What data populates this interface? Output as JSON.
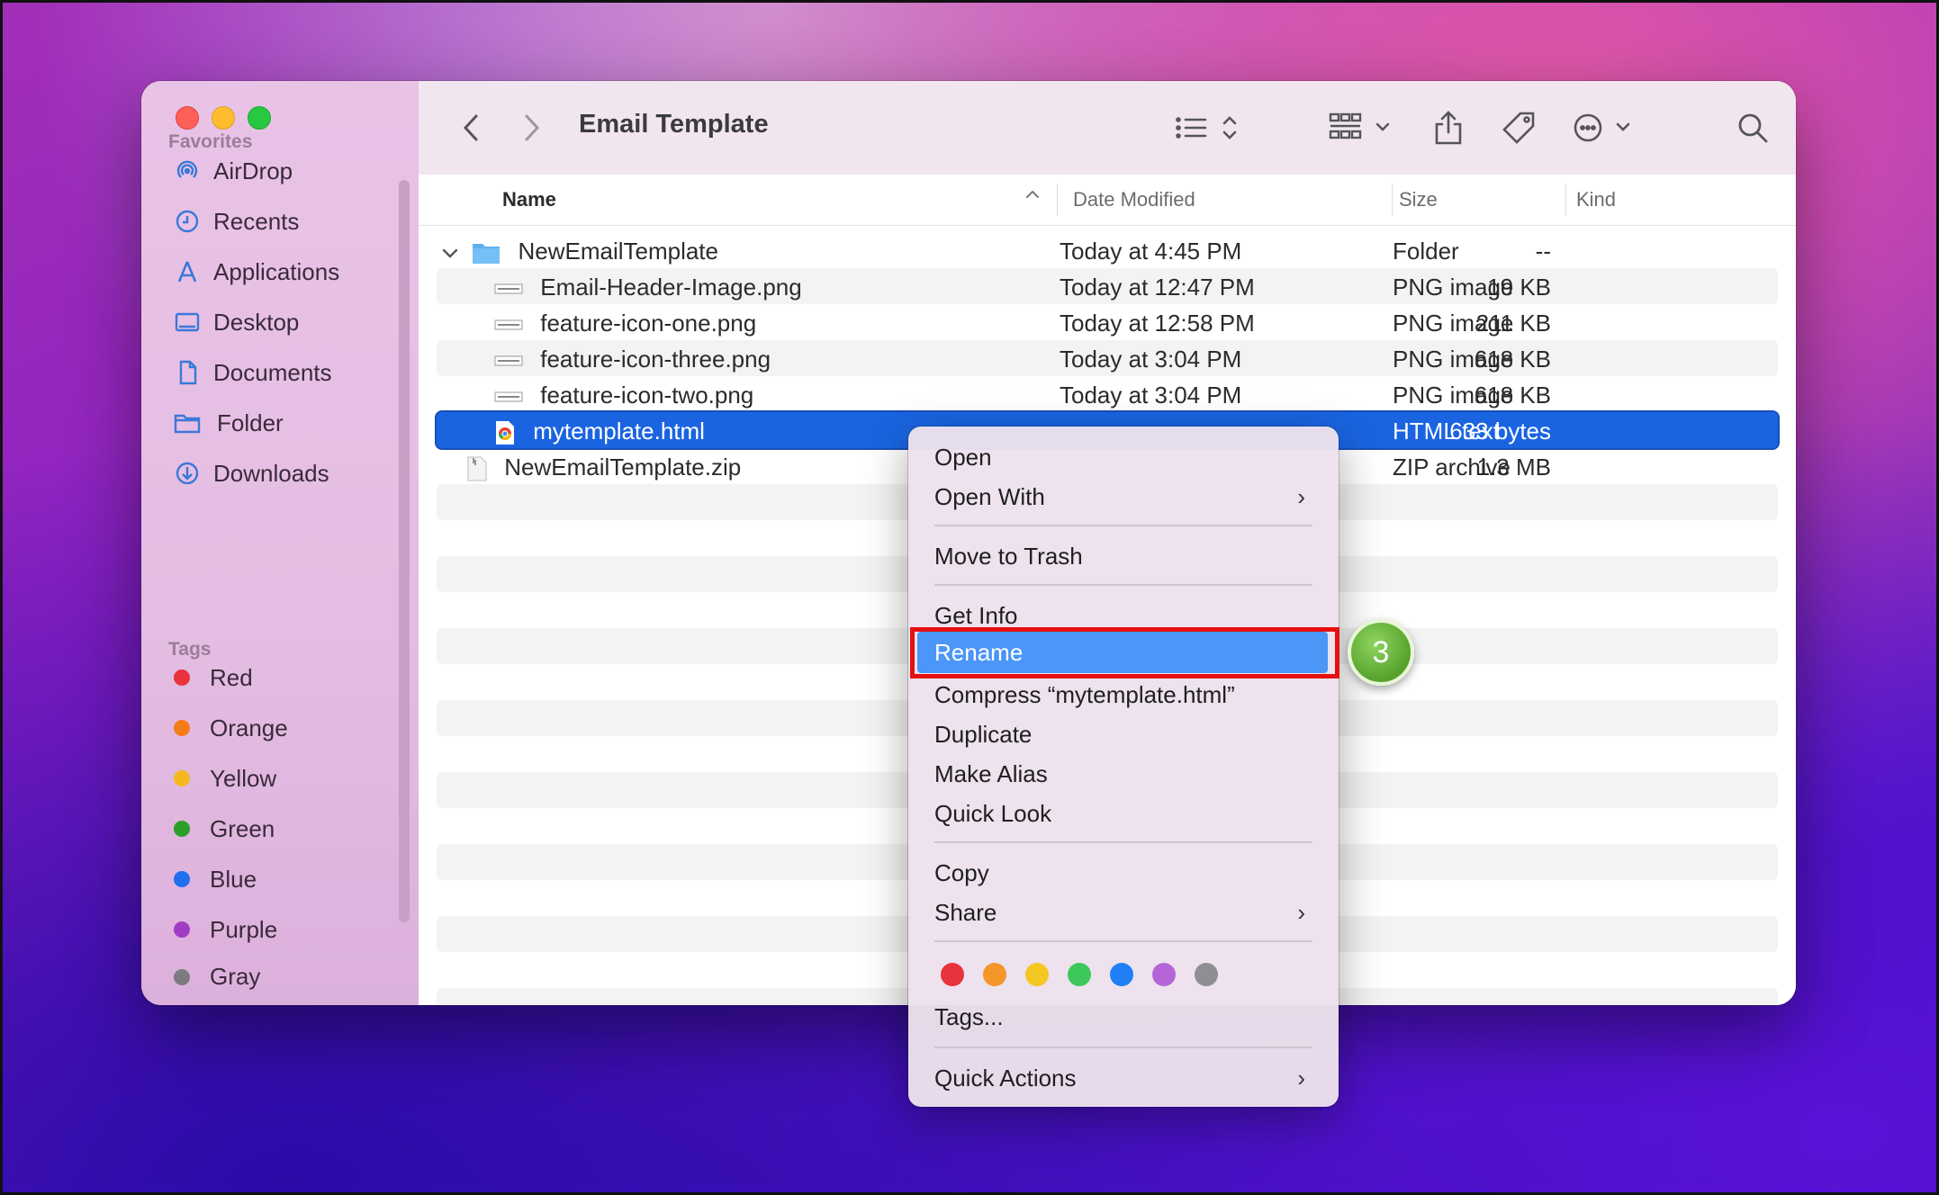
{
  "window": {
    "title": "Email Template"
  },
  "sidebar": {
    "favorites_header": "Favorites",
    "favorites": [
      {
        "label": "AirDrop",
        "icon": "airdrop-icon"
      },
      {
        "label": "Recents",
        "icon": "clock-icon"
      },
      {
        "label": "Applications",
        "icon": "applications-icon"
      },
      {
        "label": "Desktop",
        "icon": "desktop-icon"
      },
      {
        "label": "Documents",
        "icon": "document-icon"
      },
      {
        "label": "Folder",
        "icon": "folder-icon"
      },
      {
        "label": "Downloads",
        "icon": "download-icon"
      }
    ],
    "tags_header": "Tags",
    "tags": [
      {
        "label": "Red",
        "color": "#e8323c"
      },
      {
        "label": "Orange",
        "color": "#f57d19"
      },
      {
        "label": "Yellow",
        "color": "#f5b81e"
      },
      {
        "label": "Green",
        "color": "#2aa02a"
      },
      {
        "label": "Blue",
        "color": "#1f6ff0"
      },
      {
        "label": "Purple",
        "color": "#a13dc4"
      },
      {
        "label": "Gray",
        "color": "#7c7c80"
      }
    ]
  },
  "columns": {
    "name": "Name",
    "date": "Date Modified",
    "size": "Size",
    "kind": "Kind"
  },
  "files": [
    {
      "name": "NewEmailTemplate",
      "date": "Today at 4:45 PM",
      "size": "--",
      "kind": "Folder",
      "type": "folder"
    },
    {
      "name": "Email-Header-Image.png",
      "date": "Today at 12:47 PM",
      "size": "19 KB",
      "kind": "PNG image",
      "type": "png"
    },
    {
      "name": "feature-icon-one.png",
      "date": "Today at 12:58 PM",
      "size": "211 KB",
      "kind": "PNG image",
      "type": "png"
    },
    {
      "name": "feature-icon-three.png",
      "date": "Today at 3:04 PM",
      "size": "618 KB",
      "kind": "PNG image",
      "type": "png"
    },
    {
      "name": "feature-icon-two.png",
      "date": "Today at 3:04 PM",
      "size": "618 KB",
      "kind": "PNG image",
      "type": "png"
    },
    {
      "name": "mytemplate.html",
      "date": "",
      "size": "633 bytes",
      "kind": "HTML text",
      "type": "html",
      "selected": true
    },
    {
      "name": "NewEmailTemplate.zip",
      "date": "",
      "size": "1.3 MB",
      "kind": "ZIP archive",
      "type": "zip"
    }
  ],
  "context_menu": {
    "open": "Open",
    "open_with": "Open With",
    "move_to_trash": "Move to Trash",
    "get_info": "Get Info",
    "rename": "Rename",
    "compress": "Compress “mytemplate.html”",
    "duplicate": "Duplicate",
    "make_alias": "Make Alias",
    "quick_look": "Quick Look",
    "copy": "Copy",
    "share": "Share",
    "tag_colors": [
      "#e8323c",
      "#f5962a",
      "#f5c723",
      "#3cc85a",
      "#1f80f5",
      "#b466d8",
      "#8e8e93"
    ],
    "tags": "Tags...",
    "quick_actions": "Quick Actions"
  },
  "step_badge": "3"
}
